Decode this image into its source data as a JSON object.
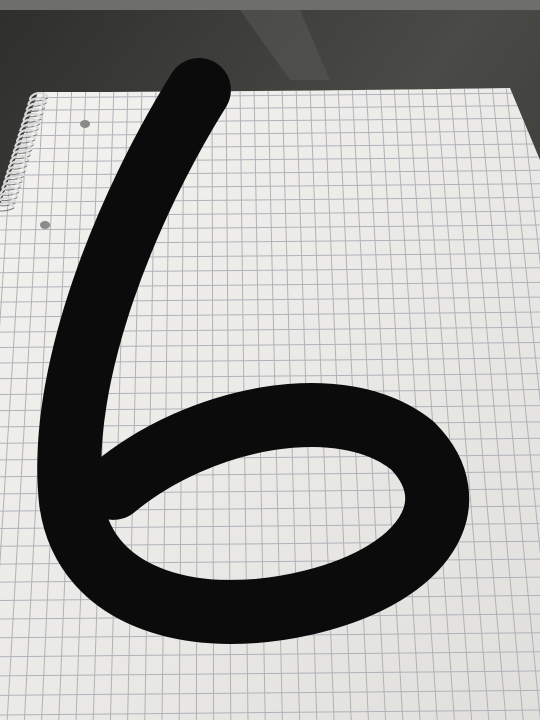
{
  "scene": {
    "subject": "spiral-notebook-grid-paper",
    "handwritten_digit": "6",
    "colors": {
      "table": "#3a3a38",
      "table_reflection": "#4c4c49",
      "paper": "#ecebe8",
      "grid_line": "#aeb3b9",
      "ink": "#0b0b0b",
      "spiral": "#d9d9d9"
    }
  }
}
